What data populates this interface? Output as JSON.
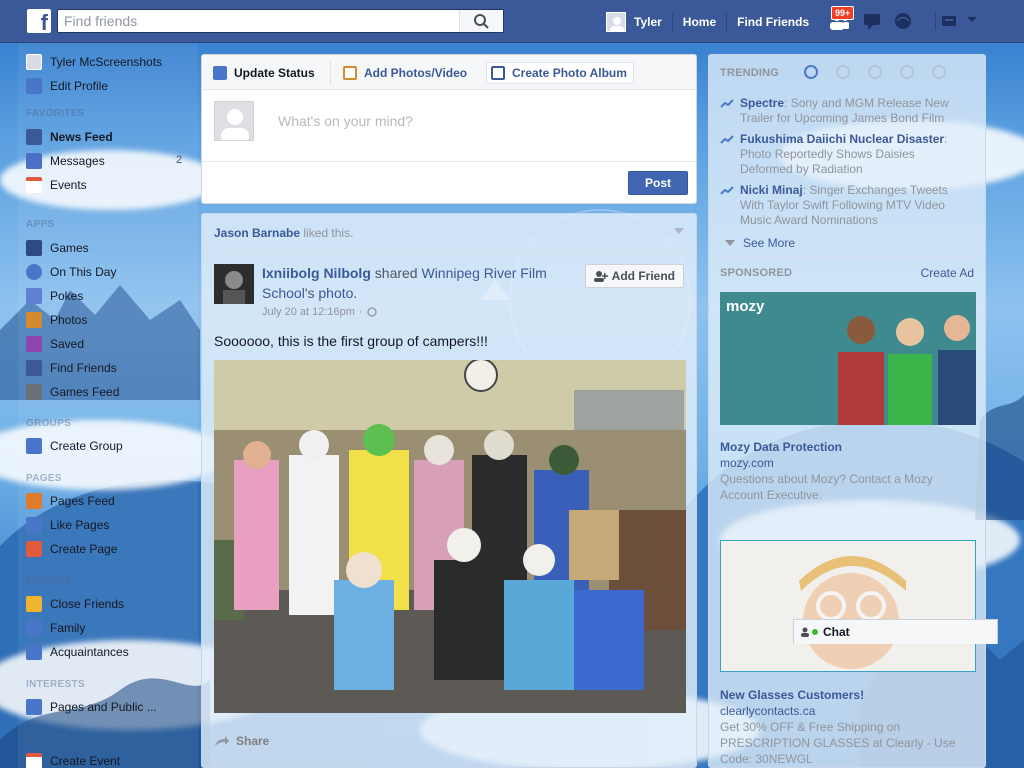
{
  "topbar": {
    "logo": "f",
    "search_placeholder": "Find friends",
    "user_name": "Tyler",
    "nav": [
      "Home",
      "Find Friends"
    ],
    "friend_requests_badge": "99+"
  },
  "sidebar": {
    "profile": {
      "name": "Tyler McScreenshots",
      "edit": "Edit Profile"
    },
    "favorites_title": "FAVORITES",
    "favorites": [
      {
        "label": "News Feed",
        "bold": true,
        "color": "#3b5998"
      },
      {
        "label": "Messages",
        "count": "2",
        "color": "#4a6fc4"
      },
      {
        "label": "Events",
        "color": "#e05a3c"
      }
    ],
    "apps_title": "APPS",
    "apps": [
      {
        "label": "Games",
        "color": "#2e4a86"
      },
      {
        "label": "On This Day",
        "color": "#4a76c9"
      },
      {
        "label": "Pokes",
        "color": "#5f7fd0"
      },
      {
        "label": "Photos",
        "color": "#d48a2e"
      },
      {
        "label": "Saved",
        "color": "#8e44ad"
      },
      {
        "label": "Find Friends",
        "color": "#3b5998"
      },
      {
        "label": "Games Feed",
        "color": "#6a6f78"
      }
    ],
    "groups_title": "GROUPS",
    "groups": [
      {
        "label": "Create Group",
        "color": "#4a76c9"
      }
    ],
    "pages_title": "PAGES",
    "pages": [
      {
        "label": "Pages Feed",
        "color": "#e07b2e"
      },
      {
        "label": "Like Pages",
        "color": "#4a76c9"
      },
      {
        "label": "Create Page",
        "color": "#e05a3c"
      }
    ],
    "friends_title": "FRIENDS",
    "friends": [
      {
        "label": "Close Friends",
        "color": "#f0b52e"
      },
      {
        "label": "Family",
        "color": "#4a76c9"
      },
      {
        "label": "Acquaintances",
        "color": "#4a76c9"
      }
    ],
    "interests_title": "INTERESTS",
    "interests": [
      {
        "label": "Pages and Public ...",
        "color": "#4a76c9"
      }
    ],
    "events_title": "EVENTS",
    "events": [
      {
        "label": "Create Event",
        "color": "#e05a3c"
      }
    ]
  },
  "composer": {
    "tabs": [
      "Update Status",
      "Add Photos/Video",
      "Create Photo Album"
    ],
    "placeholder": "What's on your mind?",
    "post_label": "Post"
  },
  "story": {
    "liker": "Jason Barnabe",
    "liked_text": "liked this.",
    "author": "Ixniibolg Nilbolg",
    "shared_text": "shared",
    "page_name": "Winnipeg River Film School",
    "possessive": "'s",
    "photo_word": "photo.",
    "timestamp": "July 20 at 12:16pm",
    "add_friend_label": "Add Friend",
    "text": "Soooooo, this is the first group of campers!!!",
    "share_label": "Share"
  },
  "trending": {
    "title": "TRENDING",
    "items": [
      {
        "name": "Spectre",
        "desc": ": Sony and MGM Release New Trailer for Upcoming James Bond Film"
      },
      {
        "name": "Fukushima Daiichi Nuclear Disaster",
        "desc": ": Photo Reportedly Shows Daisies Deformed by Radiation"
      },
      {
        "name": "Nicki Minaj",
        "desc": ": Singer Exchanges Tweets With Taylor Swift Following MTV Video Music Award Nominations"
      }
    ],
    "see_more": "See More"
  },
  "sponsored": {
    "title": "SPONSORED",
    "create_ad": "Create Ad",
    "ads": [
      {
        "brand_logo": "mozy",
        "title": "Mozy Data Protection",
        "domain": "mozy.com",
        "desc": "Questions about Mozy? Contact a Mozy Account Executive."
      },
      {
        "title": "New Glasses Customers!",
        "domain": "clearlycontacts.ca",
        "desc": "Get 30% OFF & Free Shipping on PRESCRIPTION GLASSES at Clearly - Use Code: 30NEWGL"
      }
    ]
  },
  "chat": {
    "label": "Chat"
  }
}
